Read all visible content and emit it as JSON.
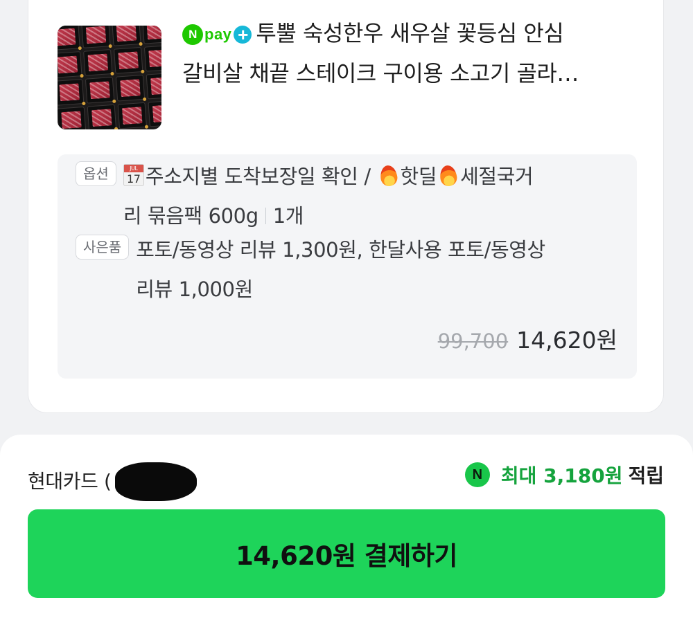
{
  "product": {
    "image_alt": "marinated beef cuts in black trays",
    "badge": {
      "n": "N",
      "word": "pay",
      "plus": "+"
    },
    "title_line1": "투뿔 숙성한우 새우살 꽃등심 안심",
    "title_line2": "갈비살 채끝 스테이크 구이용 소고기 골라…"
  },
  "option": {
    "tag": "옵션",
    "text_a": "주소지별 도착보장일 확인 / ",
    "text_b": "핫딜",
    "text_c": "세절국거",
    "text_d": "리 묶음팩 600g",
    "quantity": "1개"
  },
  "gift": {
    "tag": "사은품",
    "line1": "포토/동영상 리뷰 1,300원, 한달사용 포토/동영상",
    "line2": "리뷰 1,000원"
  },
  "price": {
    "original": "99,700",
    "sale": "14,620원"
  },
  "payment": {
    "card_name": "현대카드 (",
    "reward_icon": "N",
    "reward_amount": "최대 3,180원",
    "reward_suffix": "적립",
    "pay_button_label": "14,620원 결제하기"
  },
  "colors": {
    "accent_green": "#1ed45a",
    "npay_green": "#1ec800",
    "reward_green": "#15a33d"
  }
}
